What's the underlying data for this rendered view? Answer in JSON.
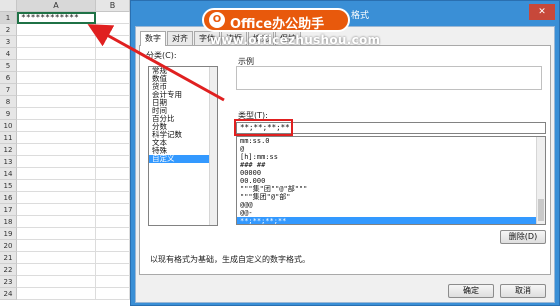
{
  "sheet": {
    "columns": [
      "A",
      "B"
    ],
    "rows": [
      "1",
      "2",
      "3",
      "4",
      "5",
      "6",
      "7",
      "8",
      "9",
      "10",
      "11",
      "12",
      "13",
      "14",
      "15",
      "16",
      "17",
      "18",
      "19",
      "20",
      "21",
      "22",
      "23",
      "24"
    ],
    "cell_a1": "************"
  },
  "dialog": {
    "title": "格式",
    "close_glyph": "✕",
    "tabs": [
      "数字",
      "对齐",
      "字体",
      "边框",
      "填充",
      "保护"
    ],
    "active_tab": "数字",
    "category_label": "分类(C):",
    "categories": [
      "常规",
      "数值",
      "货币",
      "会计专用",
      "日期",
      "时间",
      "百分比",
      "分数",
      "科学记数",
      "文本",
      "特殊",
      "自定义"
    ],
    "selected_category": "自定义",
    "sample_label": "示例",
    "type_label": "类型(T):",
    "type_value": "**;**;**;**",
    "formats": [
      "mm:ss.0",
      "@",
      "[h]:mm:ss",
      "### ##",
      "00000",
      "00.000",
      "\"\"\"集\"团\"\"@\"部\"\"\"",
      "\"\"\"集团\"@\"部\"",
      "@@@",
      "@@-",
      "**;**;**;**"
    ],
    "selected_format": "**;**;**;**",
    "delete_label": "删除(D)",
    "description": "以现有格式为基础，生成自定义的数字格式。",
    "ok_label": "确定",
    "cancel_label": "取消"
  },
  "watermark": {
    "badge_text": "Office办公助手",
    "url": "www.officezhushou.com"
  },
  "colors": {
    "dialog_frame": "#3a8fd6",
    "selection": "#3399ff",
    "highlight_box": "#e02020",
    "badge": "#e8590c",
    "cell_border": "#1f7246"
  }
}
